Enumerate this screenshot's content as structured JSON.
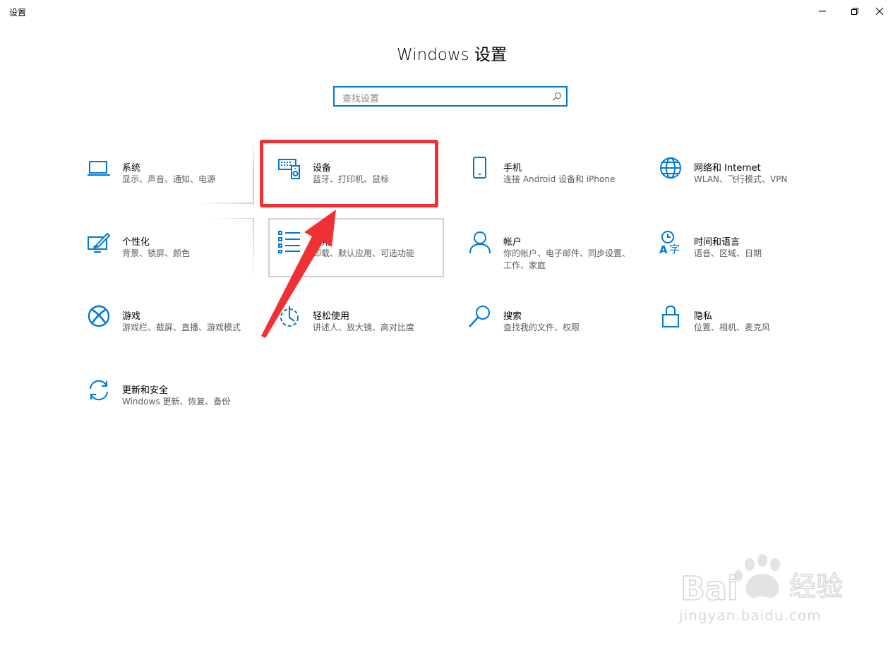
{
  "window": {
    "title": "设置"
  },
  "header": {
    "title": "Windows 设置"
  },
  "search": {
    "placeholder": "查找设置"
  },
  "tiles": [
    {
      "title": "系统",
      "desc": "显示、声音、通知、电源",
      "icon": "laptop-icon"
    },
    {
      "title": "设备",
      "desc": "蓝牙、打印机、鼠标",
      "icon": "keyboard-speaker-icon"
    },
    {
      "title": "手机",
      "desc": "连接 Android 设备和 iPhone",
      "icon": "phone-icon"
    },
    {
      "title": "网络和 Internet",
      "desc": "WLAN、飞行模式、VPN",
      "icon": "globe-icon"
    },
    {
      "title": "个性化",
      "desc": "背景、锁屏、颜色",
      "icon": "paint-icon"
    },
    {
      "title": "应用",
      "desc": "卸载、默认应用、可选功能",
      "icon": "apps-list-icon"
    },
    {
      "title": "帐户",
      "desc": "你的帐户、电子邮件、同步设置、工作、家庭",
      "icon": "person-icon"
    },
    {
      "title": "时间和语言",
      "desc": "语音、区域、日期",
      "icon": "time-language-icon"
    },
    {
      "title": "游戏",
      "desc": "游戏栏、截屏、直播、游戏模式",
      "icon": "xbox-icon"
    },
    {
      "title": "轻松使用",
      "desc": "讲述人、放大镜、高对比度",
      "icon": "ease-of-access-icon"
    },
    {
      "title": "搜索",
      "desc": "查找我的文件、权限",
      "icon": "search-icon"
    },
    {
      "title": "隐私",
      "desc": "位置、相机、麦克风",
      "icon": "lock-icon"
    },
    {
      "title": "更新和安全",
      "desc": "Windows 更新、恢复、备份",
      "icon": "update-icon"
    }
  ],
  "annotation": {
    "highlight_color": "#f13033",
    "highlighted_tile": "设备"
  },
  "watermark": {
    "logo": "Baidu 经验",
    "url": "jingyan.baidu.com"
  },
  "colors": {
    "accent": "#0078d7"
  }
}
